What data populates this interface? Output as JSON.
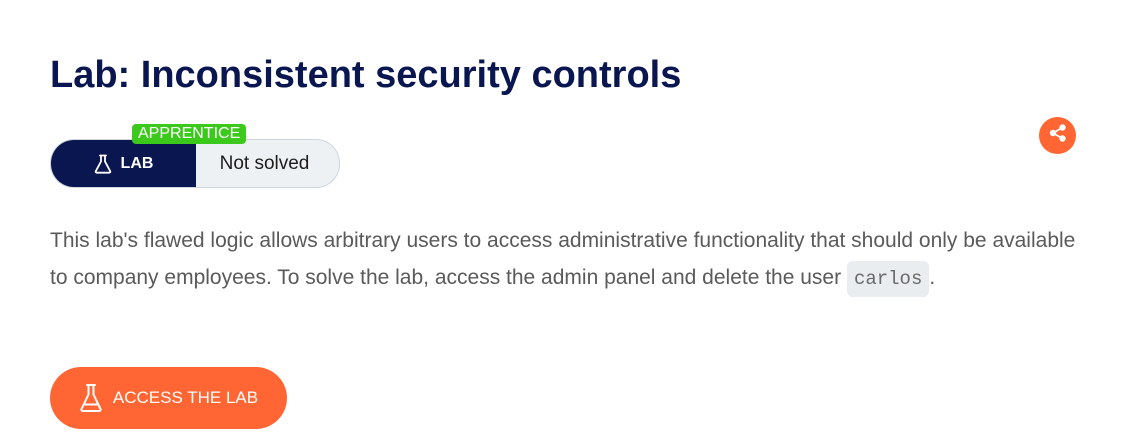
{
  "title": "Lab: Inconsistent security controls",
  "status": {
    "level": "APPRENTICE",
    "lab_label": "LAB",
    "state": "Not solved"
  },
  "share": {
    "icon": "share-icon"
  },
  "description": {
    "text": "This lab's flawed logic allows arbitrary users to access administrative functionality that should only be available to company employees. To solve the lab, access the admin panel and delete the user ",
    "code": "carlos",
    "suffix": "."
  },
  "access_button": {
    "label": "ACCESS THE LAB",
    "icon": "flask-icon"
  },
  "colors": {
    "navy": "#0a1650",
    "orange": "#ff6633",
    "green": "#3bca1b"
  }
}
